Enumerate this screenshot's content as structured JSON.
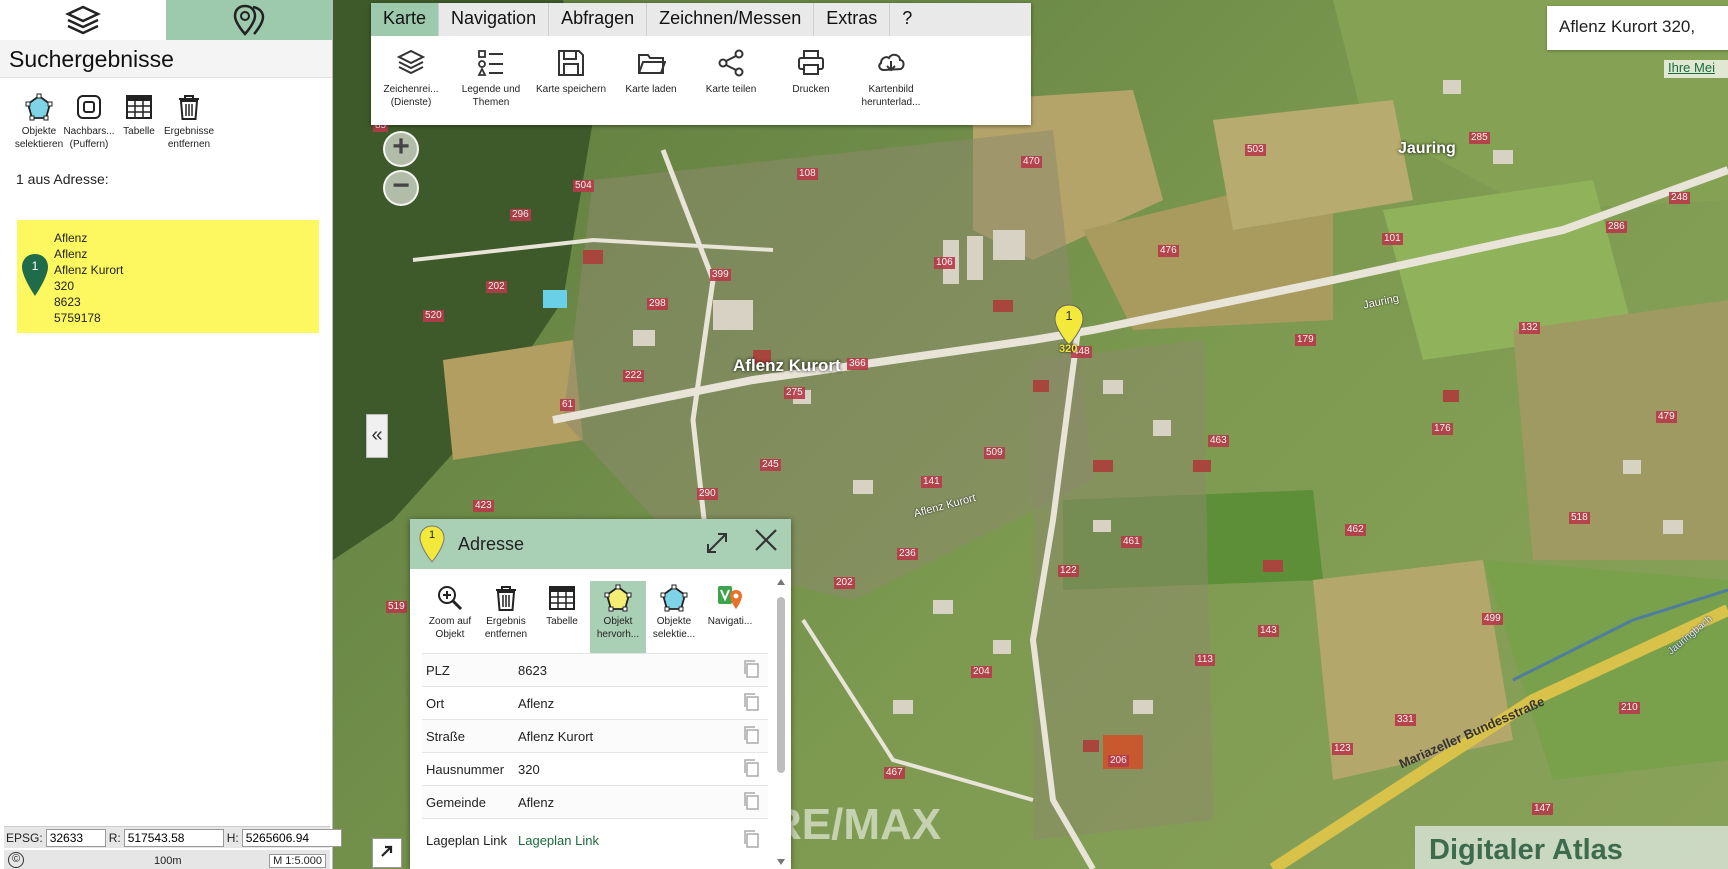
{
  "left_panel": {
    "title": "Suchergebnisse",
    "tools": [
      {
        "icon": "polygon-select-icon",
        "label": "Objekte selektieren"
      },
      {
        "icon": "buffer-icon",
        "label": "Nachbars... (Puffern)"
      },
      {
        "icon": "table-icon",
        "label": "Tabelle"
      },
      {
        "icon": "trash-icon",
        "label": "Ergebnisse entfernen"
      }
    ],
    "result_count": "1 aus Adresse:",
    "result": {
      "pin_number": "1",
      "lines": [
        "Aflenz",
        "Aflenz",
        "Aflenz Kurort",
        "320",
        "8623",
        "5759178"
      ]
    }
  },
  "coords": {
    "epsg_label": "EPSG:",
    "epsg": "32633",
    "r_label": "R:",
    "r": "517543.58",
    "h_label": "H:",
    "h": "5265606.94",
    "scale_text": "100m",
    "copyright": "©",
    "scale": "M 1:5.000"
  },
  "menu": {
    "tabs": [
      "Karte",
      "Navigation",
      "Abfragen",
      "Zeichnen/Messen",
      "Extras",
      "?"
    ],
    "tools": [
      {
        "icon": "layers-icon",
        "label": "Zeichenrei... (Dienste)"
      },
      {
        "icon": "legend-icon",
        "label": "Legende und Themen"
      },
      {
        "icon": "save-icon",
        "label": "Karte speichern"
      },
      {
        "icon": "folder-icon",
        "label": "Karte laden"
      },
      {
        "icon": "share-icon",
        "label": "Karte teilen"
      },
      {
        "icon": "print-icon",
        "label": "Drucken"
      },
      {
        "icon": "cloud-download-icon",
        "label": "Kartenbild herunterlad..."
      }
    ]
  },
  "zoom": {
    "in": "+",
    "out": "−"
  },
  "collapse": "«",
  "search": {
    "value": "Aflenz Kurort 320,",
    "more": "Ihre Mei"
  },
  "map": {
    "place_labels": [
      "Aflenz Kurort",
      "Jauring"
    ],
    "road_labels": [
      "Aflenz Kurort",
      "Jauring",
      "Mariazeller Bundesstraße",
      "Jauringbach"
    ],
    "marker_number": "1",
    "marker_label": "320"
  },
  "popup": {
    "pin_number": "1",
    "title": "Adresse",
    "tools": [
      {
        "icon": "zoom-object-icon",
        "label": "Zoom auf Objekt"
      },
      {
        "icon": "trash-icon",
        "label": "Ergebnis entfernen"
      },
      {
        "icon": "table-icon",
        "label": "Tabelle"
      },
      {
        "icon": "highlight-icon",
        "label": "Objekt hervorh..."
      },
      {
        "icon": "polygon-select-icon",
        "label": "Objekte selektie..."
      },
      {
        "icon": "navigation-icon",
        "label": "Navigati..."
      }
    ],
    "rows": [
      {
        "key": "PLZ",
        "value": "8623"
      },
      {
        "key": "Ort",
        "value": "Aflenz"
      },
      {
        "key": "Straße",
        "value": "Aflenz Kurort"
      },
      {
        "key": "Hausnummer",
        "value": "320"
      },
      {
        "key": "Gemeinde",
        "value": "Aflenz"
      },
      {
        "key": "Lageplan Link",
        "value": "Lageplan Link"
      }
    ]
  },
  "watermark": "RE/MAX",
  "atlas_logo": "Digitaler Atlas",
  "colors": {
    "accent": "#9dc9ad",
    "highlight": "#fdf85f",
    "pin": "#1f6b4a",
    "marker": "#f2e93a",
    "house_label": "#b83a4a"
  }
}
